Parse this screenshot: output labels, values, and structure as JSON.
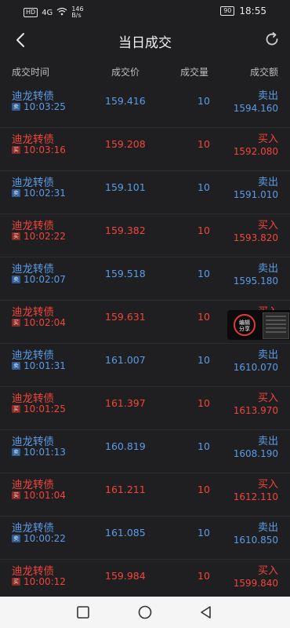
{
  "status": {
    "hd": "HD",
    "signal": "4G",
    "speed_value": "146",
    "speed_unit": "B/s",
    "battery": "90",
    "time": "18:55"
  },
  "header": {
    "title": "当日成交"
  },
  "columns": {
    "time": "成交时间",
    "price": "成交价",
    "volume": "成交量",
    "amount": "成交额"
  },
  "rows": [
    {
      "name": "迪龙转债",
      "tag": "卖",
      "time": "10:03:25",
      "price": "159.416",
      "volume": "10",
      "side": "卖出",
      "amount": "1594.160",
      "type": "sell"
    },
    {
      "name": "迪龙转债",
      "tag": "买",
      "time": "10:03:16",
      "price": "159.208",
      "volume": "10",
      "side": "买入",
      "amount": "1592.080",
      "type": "buy"
    },
    {
      "name": "迪龙转债",
      "tag": "卖",
      "time": "10:02:31",
      "price": "159.101",
      "volume": "10",
      "side": "卖出",
      "amount": "1591.010",
      "type": "sell"
    },
    {
      "name": "迪龙转债",
      "tag": "买",
      "time": "10:02:22",
      "price": "159.382",
      "volume": "10",
      "side": "买入",
      "amount": "1593.820",
      "type": "buy"
    },
    {
      "name": "迪龙转债",
      "tag": "卖",
      "time": "10:02:07",
      "price": "159.518",
      "volume": "10",
      "side": "卖出",
      "amount": "1595.180",
      "type": "sell"
    },
    {
      "name": "迪龙转债",
      "tag": "买",
      "time": "10:02:04",
      "price": "159.631",
      "volume": "10",
      "side": "买入",
      "amount": "",
      "type": "buy"
    },
    {
      "name": "迪龙转债",
      "tag": "卖",
      "time": "10:01:31",
      "price": "161.007",
      "volume": "10",
      "side": "卖出",
      "amount": "1610.070",
      "type": "sell"
    },
    {
      "name": "迪龙转债",
      "tag": "买",
      "time": "10:01:25",
      "price": "161.397",
      "volume": "10",
      "side": "买入",
      "amount": "1613.970",
      "type": "buy"
    },
    {
      "name": "迪龙转债",
      "tag": "卖",
      "time": "10:01:13",
      "price": "160.819",
      "volume": "10",
      "side": "卖出",
      "amount": "1608.190",
      "type": "sell"
    },
    {
      "name": "迪龙转债",
      "tag": "买",
      "time": "10:01:04",
      "price": "161.211",
      "volume": "10",
      "side": "买入",
      "amount": "1612.110",
      "type": "buy"
    },
    {
      "name": "迪龙转债",
      "tag": "卖",
      "time": "10:00:22",
      "price": "161.085",
      "volume": "10",
      "side": "卖出",
      "amount": "1610.850",
      "type": "sell"
    },
    {
      "name": "迪龙转债",
      "tag": "买",
      "time": "10:00:12",
      "price": "159.984",
      "volume": "10",
      "side": "买入",
      "amount": "1599.840",
      "type": "buy"
    }
  ],
  "float_widget": {
    "label_line1": "编辑",
    "label_line2": "分享"
  },
  "colors": {
    "sell": "#5b9be6",
    "buy": "#f0453b",
    "background": "#1f1f21"
  }
}
